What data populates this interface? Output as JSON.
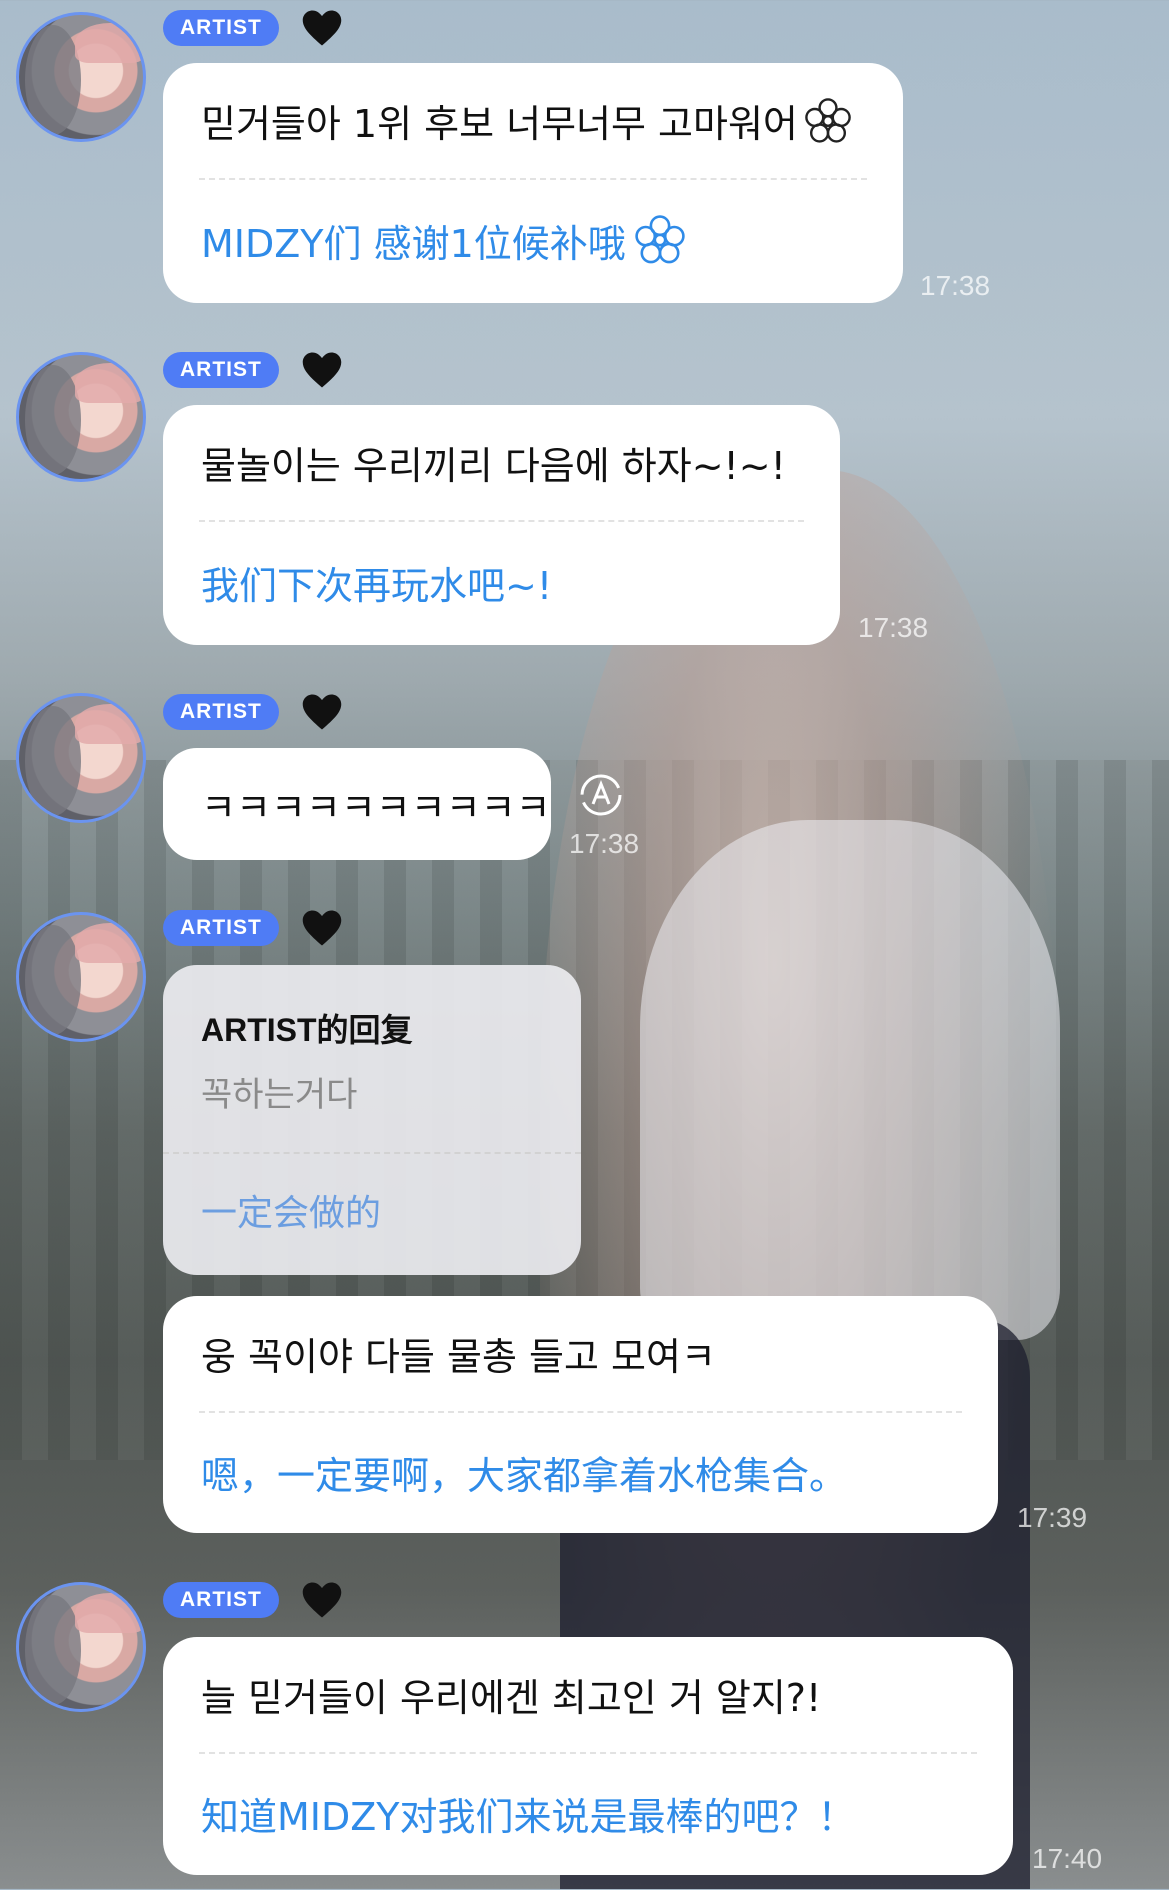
{
  "badge_label": "ARTIST",
  "messages": [
    {
      "ko": "믿거들아 1위 후보 너무너무 고마워어",
      "zh": "MIDZY们 感谢1位候补哦",
      "time": "17:38"
    },
    {
      "ko": "물놀이는 우리끼리 다음에 하자~!~!",
      "zh": "我们下次再玩水吧~!",
      "time": "17:38"
    },
    {
      "ko": "ㅋㅋㅋㅋㅋㅋㅋㅋㅋㅋ",
      "time": "17:38"
    },
    {
      "ko": "웅 꼭이야 다들 물총 들고 모여ㅋ",
      "zh": "嗯，一定要啊，大家都拿着水枪集合。",
      "time": "17:39"
    },
    {
      "ko": "늘 믿거들이 우리에겐 최고인 거 알지?!",
      "zh": "知道MIDZY对我们来说是最棒的吧？！",
      "time": "17:40"
    }
  ],
  "reply": {
    "title": "ARTIST的回复",
    "ko": "꼭하는거다",
    "zh": "一定会做的"
  },
  "icons": {
    "heart": "black-heart-icon",
    "flower": "flower-icon",
    "translate": "auto-translate-icon",
    "badge_color": "#4f7cf5",
    "translation_color": "#2f8be8"
  }
}
